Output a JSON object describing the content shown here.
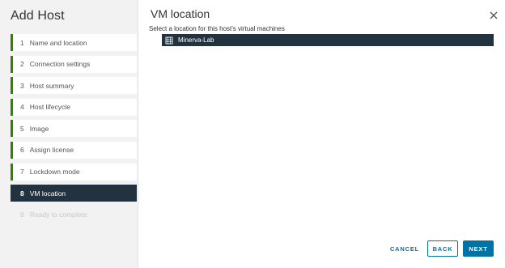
{
  "wizard": {
    "title": "Add Host",
    "steps": [
      {
        "num": "1",
        "label": "Name and location"
      },
      {
        "num": "2",
        "label": "Connection settings"
      },
      {
        "num": "3",
        "label": "Host summary"
      },
      {
        "num": "4",
        "label": "Host lifecycle"
      },
      {
        "num": "5",
        "label": "Image"
      },
      {
        "num": "6",
        "label": "Assign license"
      },
      {
        "num": "7",
        "label": "Lockdown mode"
      },
      {
        "num": "8",
        "label": "VM location"
      },
      {
        "num": "9",
        "label": "Ready to complete"
      }
    ]
  },
  "content": {
    "title": "VM location",
    "instruction": "Select a location for this host's virtual machines",
    "tree": [
      {
        "label": "Minerva-Lab",
        "icon": "datacenter-icon"
      }
    ]
  },
  "footer": {
    "cancel_label": "CANCEL",
    "back_label": "BACK",
    "next_label": "NEXT"
  },
  "colors": {
    "accent": "#0072a3",
    "completed_step": "#2f8400",
    "active_step_bg": "#22333f"
  }
}
